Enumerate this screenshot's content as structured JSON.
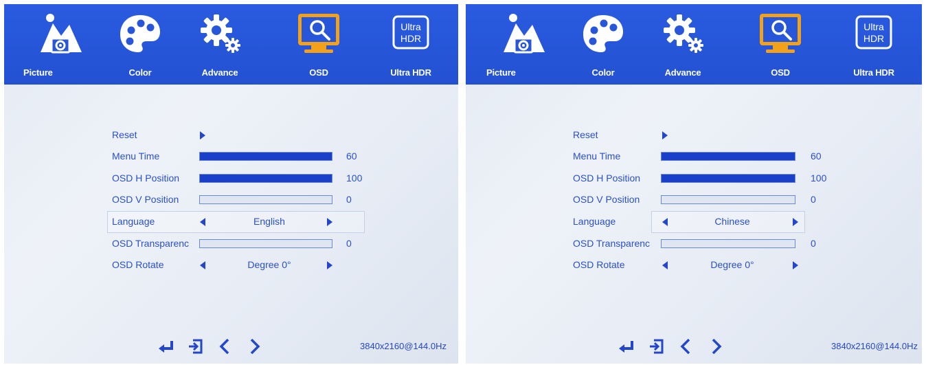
{
  "colors": {
    "header_bg": "#2856d8",
    "text": "#2a4fd0",
    "bar_fill": "#1a3fc8",
    "active_icon": "#f1a21a"
  },
  "panels": [
    {
      "tabs": [
        {
          "label": "Picture",
          "icon": "picture-icon",
          "active": false
        },
        {
          "label": "Color",
          "icon": "color-palette-icon",
          "active": false
        },
        {
          "label": "Advance",
          "icon": "gear-icon",
          "active": false
        },
        {
          "label": "OSD",
          "icon": "osd-monitor-icon",
          "active": true
        },
        {
          "label": "Ultra HDR",
          "icon": "ultra-hdr-icon",
          "icon_text_1": "Ultra",
          "icon_text_2": "HDR",
          "active": false
        }
      ],
      "menu": {
        "reset": "Reset",
        "menu_time": {
          "label": "Menu Time",
          "value": "60",
          "level": 1.0
        },
        "osd_h": {
          "label": "OSD H Position",
          "value": "100",
          "level": 1.0
        },
        "osd_v": {
          "label": "OSD V Position",
          "value": "0",
          "level": 0.0
        },
        "language": {
          "label": "Language",
          "value": "English"
        },
        "transparency": {
          "label": "OSD Transparenc",
          "value": "0",
          "level": 0.0
        },
        "rotate": {
          "label": "OSD Rotate",
          "value": "Degree 0°"
        }
      },
      "footer": {
        "resolution": "3840x2160@144.0Hz"
      }
    },
    {
      "tabs": [
        {
          "label": "Picture",
          "icon": "picture-icon",
          "active": false
        },
        {
          "label": "Color",
          "icon": "color-palette-icon",
          "active": false
        },
        {
          "label": "Advance",
          "icon": "gear-icon",
          "active": false
        },
        {
          "label": "OSD",
          "icon": "osd-monitor-icon",
          "active": true
        },
        {
          "label": "Ultra HDR",
          "icon": "ultra-hdr-icon",
          "icon_text_1": "Ultra",
          "icon_text_2": "HDR",
          "active": false
        }
      ],
      "menu": {
        "reset": "Reset",
        "menu_time": {
          "label": "Menu Time",
          "value": "60",
          "level": 1.0
        },
        "osd_h": {
          "label": "OSD H Position",
          "value": "100",
          "level": 1.0
        },
        "osd_v": {
          "label": "OSD V Position",
          "value": "0",
          "level": 0.0
        },
        "language": {
          "label": "Language",
          "value": "Chinese"
        },
        "transparency": {
          "label": "OSD Transparenc",
          "value": "0",
          "level": 0.0
        },
        "rotate": {
          "label": "OSD Rotate",
          "value": "Degree 0°"
        }
      },
      "footer": {
        "resolution": "3840x2160@144.0Hz"
      }
    }
  ]
}
